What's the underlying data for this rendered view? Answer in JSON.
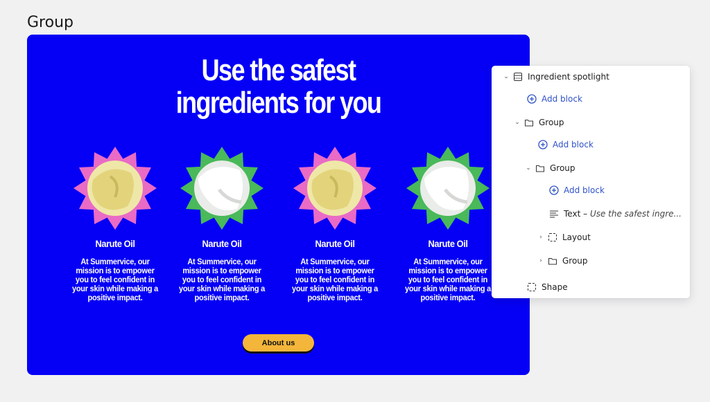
{
  "page_label": "Group",
  "hero": {
    "headline_line1": "Use the safest",
    "headline_line2": "ingredients for you",
    "cta_label": "About us"
  },
  "cards": [
    {
      "title": "Narute Oil",
      "desc": "At Summervice, our mission is to empower you to feel confident in your skin while making a positive impact.",
      "badge_color": "#e96bc5",
      "cream": "yellow"
    },
    {
      "title": "Narute Oil",
      "desc": "At Summervice, our mission is to empower you to feel confident in your skin while making a positive impact.",
      "badge_color": "#49b95a",
      "cream": "white"
    },
    {
      "title": "Narute Oil",
      "desc": "At Summervice, our mission is to empower you to feel confident in your skin while making a positive impact.",
      "badge_color": "#e96bc5",
      "cream": "yellow"
    },
    {
      "title": "Narute Oil",
      "desc": "At Summervice, our mission is to empower you to feel confident in your skin while making a positive impact.",
      "badge_color": "#49b95a",
      "cream": "white"
    }
  ],
  "tree": {
    "root": "Ingredient spotlight",
    "add_block": "Add block",
    "group": "Group",
    "text_label": "Text",
    "text_preview": "Use the safest ingre...",
    "layout": "Layout",
    "shape": "Shape"
  },
  "colors": {
    "canvas": "#0500f5",
    "cta": "#f3b63a",
    "link": "#2f52c8"
  }
}
